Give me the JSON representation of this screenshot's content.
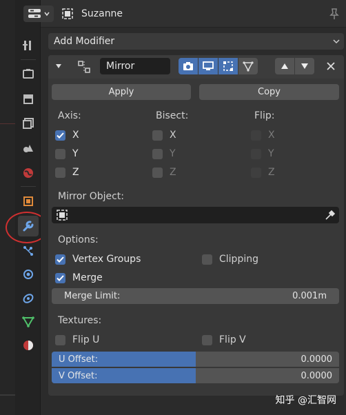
{
  "header": {
    "object_name": "Suzanne"
  },
  "add_modifier_label": "Add Modifier",
  "modifier": {
    "name": "Mirror",
    "apply_label": "Apply",
    "copy_label": "Copy",
    "axis_heading": "Axis:",
    "bisect_heading": "Bisect:",
    "flip_heading": "Flip:",
    "axis": [
      {
        "label": "X",
        "checked": true
      },
      {
        "label": "Y",
        "checked": false
      },
      {
        "label": "Z",
        "checked": false
      }
    ],
    "bisect": [
      {
        "label": "X",
        "checked": false
      },
      {
        "label": "Y",
        "checked": false
      },
      {
        "label": "Z",
        "checked": false
      }
    ],
    "flip": [
      {
        "label": "X",
        "checked": false
      },
      {
        "label": "Y",
        "checked": false
      },
      {
        "label": "Z",
        "checked": false
      }
    ],
    "mirror_object_label": "Mirror Object:",
    "options_heading": "Options:",
    "vertex_groups": {
      "label": "Vertex Groups",
      "checked": true
    },
    "clipping": {
      "label": "Clipping",
      "checked": false
    },
    "merge": {
      "label": "Merge",
      "checked": true
    },
    "merge_limit": {
      "label": "Merge Limit:",
      "value": "0.001m"
    },
    "textures_heading": "Textures:",
    "flip_u": {
      "label": "Flip U",
      "checked": false
    },
    "flip_v": {
      "label": "Flip V",
      "checked": false
    },
    "u_offset": {
      "label": "U Offset:",
      "value": "0.0000",
      "fill_fraction": 0.5
    },
    "v_offset": {
      "label": "V Offset:",
      "value": "0.0000",
      "fill_fraction": 0.5
    }
  },
  "sidebar_tabs": [
    "tool-icon",
    "render-icon",
    "output-icon",
    "view-layer-icon",
    "scene-icon",
    "world-icon",
    "object-icon",
    "modifier-icon",
    "particles-icon",
    "physics-icon",
    "constraints-icon",
    "object-data-icon",
    "material-icon"
  ],
  "watermark": "知乎 @汇智网",
  "colors": {
    "accent": "#4772b3",
    "panel": "#2b2b2b",
    "highlight_circle": "#d03030"
  }
}
